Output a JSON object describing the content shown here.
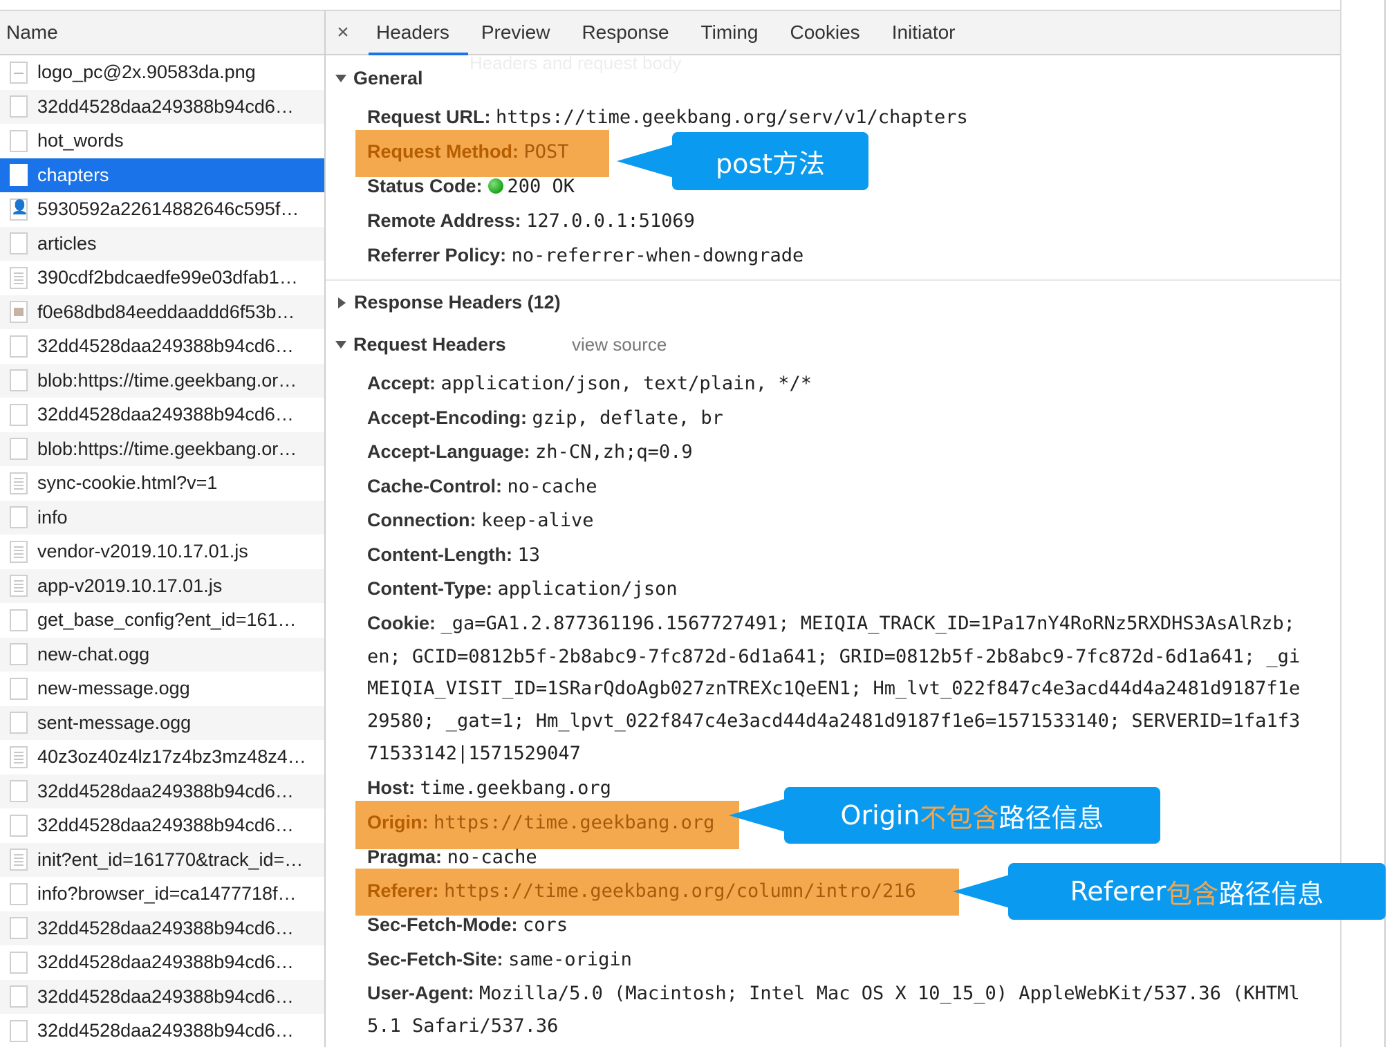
{
  "left": {
    "header": "Name",
    "requests": [
      {
        "name": "logo_pc@2x.90583da.png",
        "icon": "png-file-icon"
      },
      {
        "name": "32dd4528daa249388b94cd6…",
        "icon": "file-icon"
      },
      {
        "name": "hot_words",
        "icon": "file-icon"
      },
      {
        "name": "chapters",
        "icon": "file-icon",
        "selected": true
      },
      {
        "name": "5930592a22614882646c595f…",
        "icon": "image-file-icon"
      },
      {
        "name": "articles",
        "icon": "file-icon"
      },
      {
        "name": "390cdf2bdcaedfe99e03dfab1…",
        "icon": "doc-file-icon"
      },
      {
        "name": "f0e68dbd84eeddaaddd6f53b…",
        "icon": "image-file-icon"
      },
      {
        "name": "32dd4528daa249388b94cd6…",
        "icon": "file-icon"
      },
      {
        "name": "blob:https://time.geekbang.or…",
        "icon": "file-icon"
      },
      {
        "name": "32dd4528daa249388b94cd6…",
        "icon": "file-icon"
      },
      {
        "name": "blob:https://time.geekbang.or…",
        "icon": "file-icon"
      },
      {
        "name": "sync-cookie.html?v=1",
        "icon": "doc-file-icon"
      },
      {
        "name": "info",
        "icon": "file-icon"
      },
      {
        "name": "vendor-v2019.10.17.01.js",
        "icon": "doc-file-icon"
      },
      {
        "name": "app-v2019.10.17.01.js",
        "icon": "doc-file-icon"
      },
      {
        "name": "get_base_config?ent_id=161…",
        "icon": "file-icon"
      },
      {
        "name": "new-chat.ogg",
        "icon": "file-icon"
      },
      {
        "name": "new-message.ogg",
        "icon": "file-icon"
      },
      {
        "name": "sent-message.ogg",
        "icon": "file-icon"
      },
      {
        "name": "40z3oz40z4lz17z4bz3mz48z4…",
        "icon": "doc-file-icon"
      },
      {
        "name": "32dd4528daa249388b94cd6…",
        "icon": "file-icon"
      },
      {
        "name": "32dd4528daa249388b94cd6…",
        "icon": "file-icon"
      },
      {
        "name": "init?ent_id=161770&track_id=…",
        "icon": "doc-file-icon"
      },
      {
        "name": "info?browser_id=ca1477718f…",
        "icon": "file-icon"
      },
      {
        "name": "32dd4528daa249388b94cd6…",
        "icon": "file-icon"
      },
      {
        "name": "32dd4528daa249388b94cd6…",
        "icon": "file-icon"
      },
      {
        "name": "32dd4528daa249388b94cd6…",
        "icon": "file-icon"
      },
      {
        "name": "32dd4528daa249388b94cd6…",
        "icon": "file-icon"
      }
    ]
  },
  "tabs": {
    "close": "×",
    "items": [
      "Headers",
      "Preview",
      "Response",
      "Timing",
      "Cookies",
      "Initiator"
    ],
    "active": "Headers",
    "tooltip": "Headers and request body"
  },
  "general": {
    "title": "General",
    "request_url_k": "Request URL:",
    "request_url_v": "https://time.geekbang.org/serv/v1/chapters",
    "method_k": "Request Method:",
    "method_v": "POST",
    "status_k": "Status Code:",
    "status_v": "200 OK",
    "remote_k": "Remote Address:",
    "remote_v": "127.0.0.1:51069",
    "referrer_policy_k": "Referrer Policy:",
    "referrer_policy_v": "no-referrer-when-downgrade"
  },
  "response_headers": {
    "title": "Response Headers (12)"
  },
  "request_headers": {
    "title": "Request Headers",
    "view_source": "view source",
    "accept_k": "Accept:",
    "accept_v": "application/json, text/plain, */*",
    "encoding_k": "Accept-Encoding:",
    "encoding_v": "gzip, deflate, br",
    "language_k": "Accept-Language:",
    "language_v": "zh-CN,zh;q=0.9",
    "cache_k": "Cache-Control:",
    "cache_v": "no-cache",
    "connection_k": "Connection:",
    "connection_v": "keep-alive",
    "length_k": "Content-Length:",
    "length_v": "13",
    "type_k": "Content-Type:",
    "type_v": "application/json",
    "cookie_k": "Cookie:",
    "cookie_v1": "_ga=GA1.2.877361196.1567727491; MEIQIA_TRACK_ID=1Pa17nY4RoRNz5RXDHS3AsAlRzb;",
    "cookie_v2": "en; GCID=0812b5f-2b8abc9-7fc872d-6d1a641; GRID=0812b5f-2b8abc9-7fc872d-6d1a641; _gi",
    "cookie_v3": "MEIQIA_VISIT_ID=1SRarQdoAgb027znTREXc1QeEN1; Hm_lvt_022f847c4e3acd44d4a2481d9187f1e",
    "cookie_v4": "29580; _gat=1; Hm_lpvt_022f847c4e3acd44d4a2481d9187f1e6=1571533140; SERVERID=1fa1f3",
    "cookie_v5": "71533142|1571529047",
    "host_k": "Host:",
    "host_v": "time.geekbang.org",
    "origin_k": "Origin:",
    "origin_v": "https://time.geekbang.org",
    "pragma_k": "Pragma:",
    "pragma_v": "no-cache",
    "referer_k": "Referer:",
    "referer_v": "https://time.geekbang.org/column/intro/216",
    "fetch_mode_k": "Sec-Fetch-Mode:",
    "fetch_mode_v": "cors",
    "fetch_site_k": "Sec-Fetch-Site:",
    "fetch_site_v": "same-origin",
    "ua_k": "User-Agent:",
    "ua_v1": "Mozilla/5.0 (Macintosh; Intel Mac OS X 10_15_0) AppleWebKit/537.36 (KHTMl",
    "ua_v2": "5.1 Safari/537.36"
  },
  "callouts": {
    "post": "post方法",
    "origin_prefix": "Origin",
    "origin_zh_orange": "不包含",
    "origin_zh_white": "路径信息",
    "referer_prefix": "Referer",
    "referer_zh_orange": "包含",
    "referer_zh_white": "路径信息"
  },
  "colors": {
    "highlight": "#f5a94f",
    "callout": "#0a9af0",
    "selected_row": "#1a73e8",
    "status_dot": "#22aa22"
  }
}
